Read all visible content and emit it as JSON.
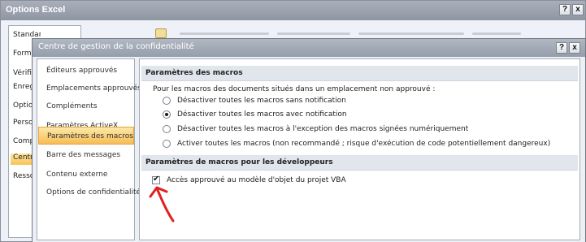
{
  "outer_window": {
    "title": "Options Excel",
    "help_btn": "?",
    "close_btn": "x",
    "nav": [
      "Standard",
      "Formules",
      "Vérification",
      "Enregistrement",
      "Options avancées",
      "Personnaliser",
      "Compléments",
      "Centre de gestion de la confidentialité",
      "Ressources"
    ],
    "nav_active_index": 7
  },
  "dialog": {
    "title": "Centre de gestion de la confidentialité",
    "help_btn": "?",
    "close_btn": "x",
    "nav": [
      "Éditeurs approuvés",
      "Emplacements approuvés",
      "Compléments",
      "Paramètres ActiveX",
      "Paramètres des macros",
      "Barre des messages",
      "Contenu externe",
      "Options de confidentialité"
    ],
    "nav_active_index": 4,
    "macros_section": {
      "header": "Paramètres des macros",
      "description": "Pour les macros des documents situés dans un emplacement non approuvé :",
      "options": [
        "Désactiver toutes les macros sans notification",
        "Désactiver toutes les macros avec notification",
        "Désactiver toutes les macros à l'exception des macros signées numériquement",
        "Activer toutes les macros (non recommandé ; risque d'exécution de code potentiellement dangereux)"
      ],
      "selected_index": 1
    },
    "dev_section": {
      "header": "Paramètres de macros pour les développeurs",
      "checkbox_label": "Accès approuvé au modèle d'objet du projet VBA",
      "checkbox_checked": true
    }
  },
  "annotation": {
    "arrow_color": "#e02020"
  }
}
